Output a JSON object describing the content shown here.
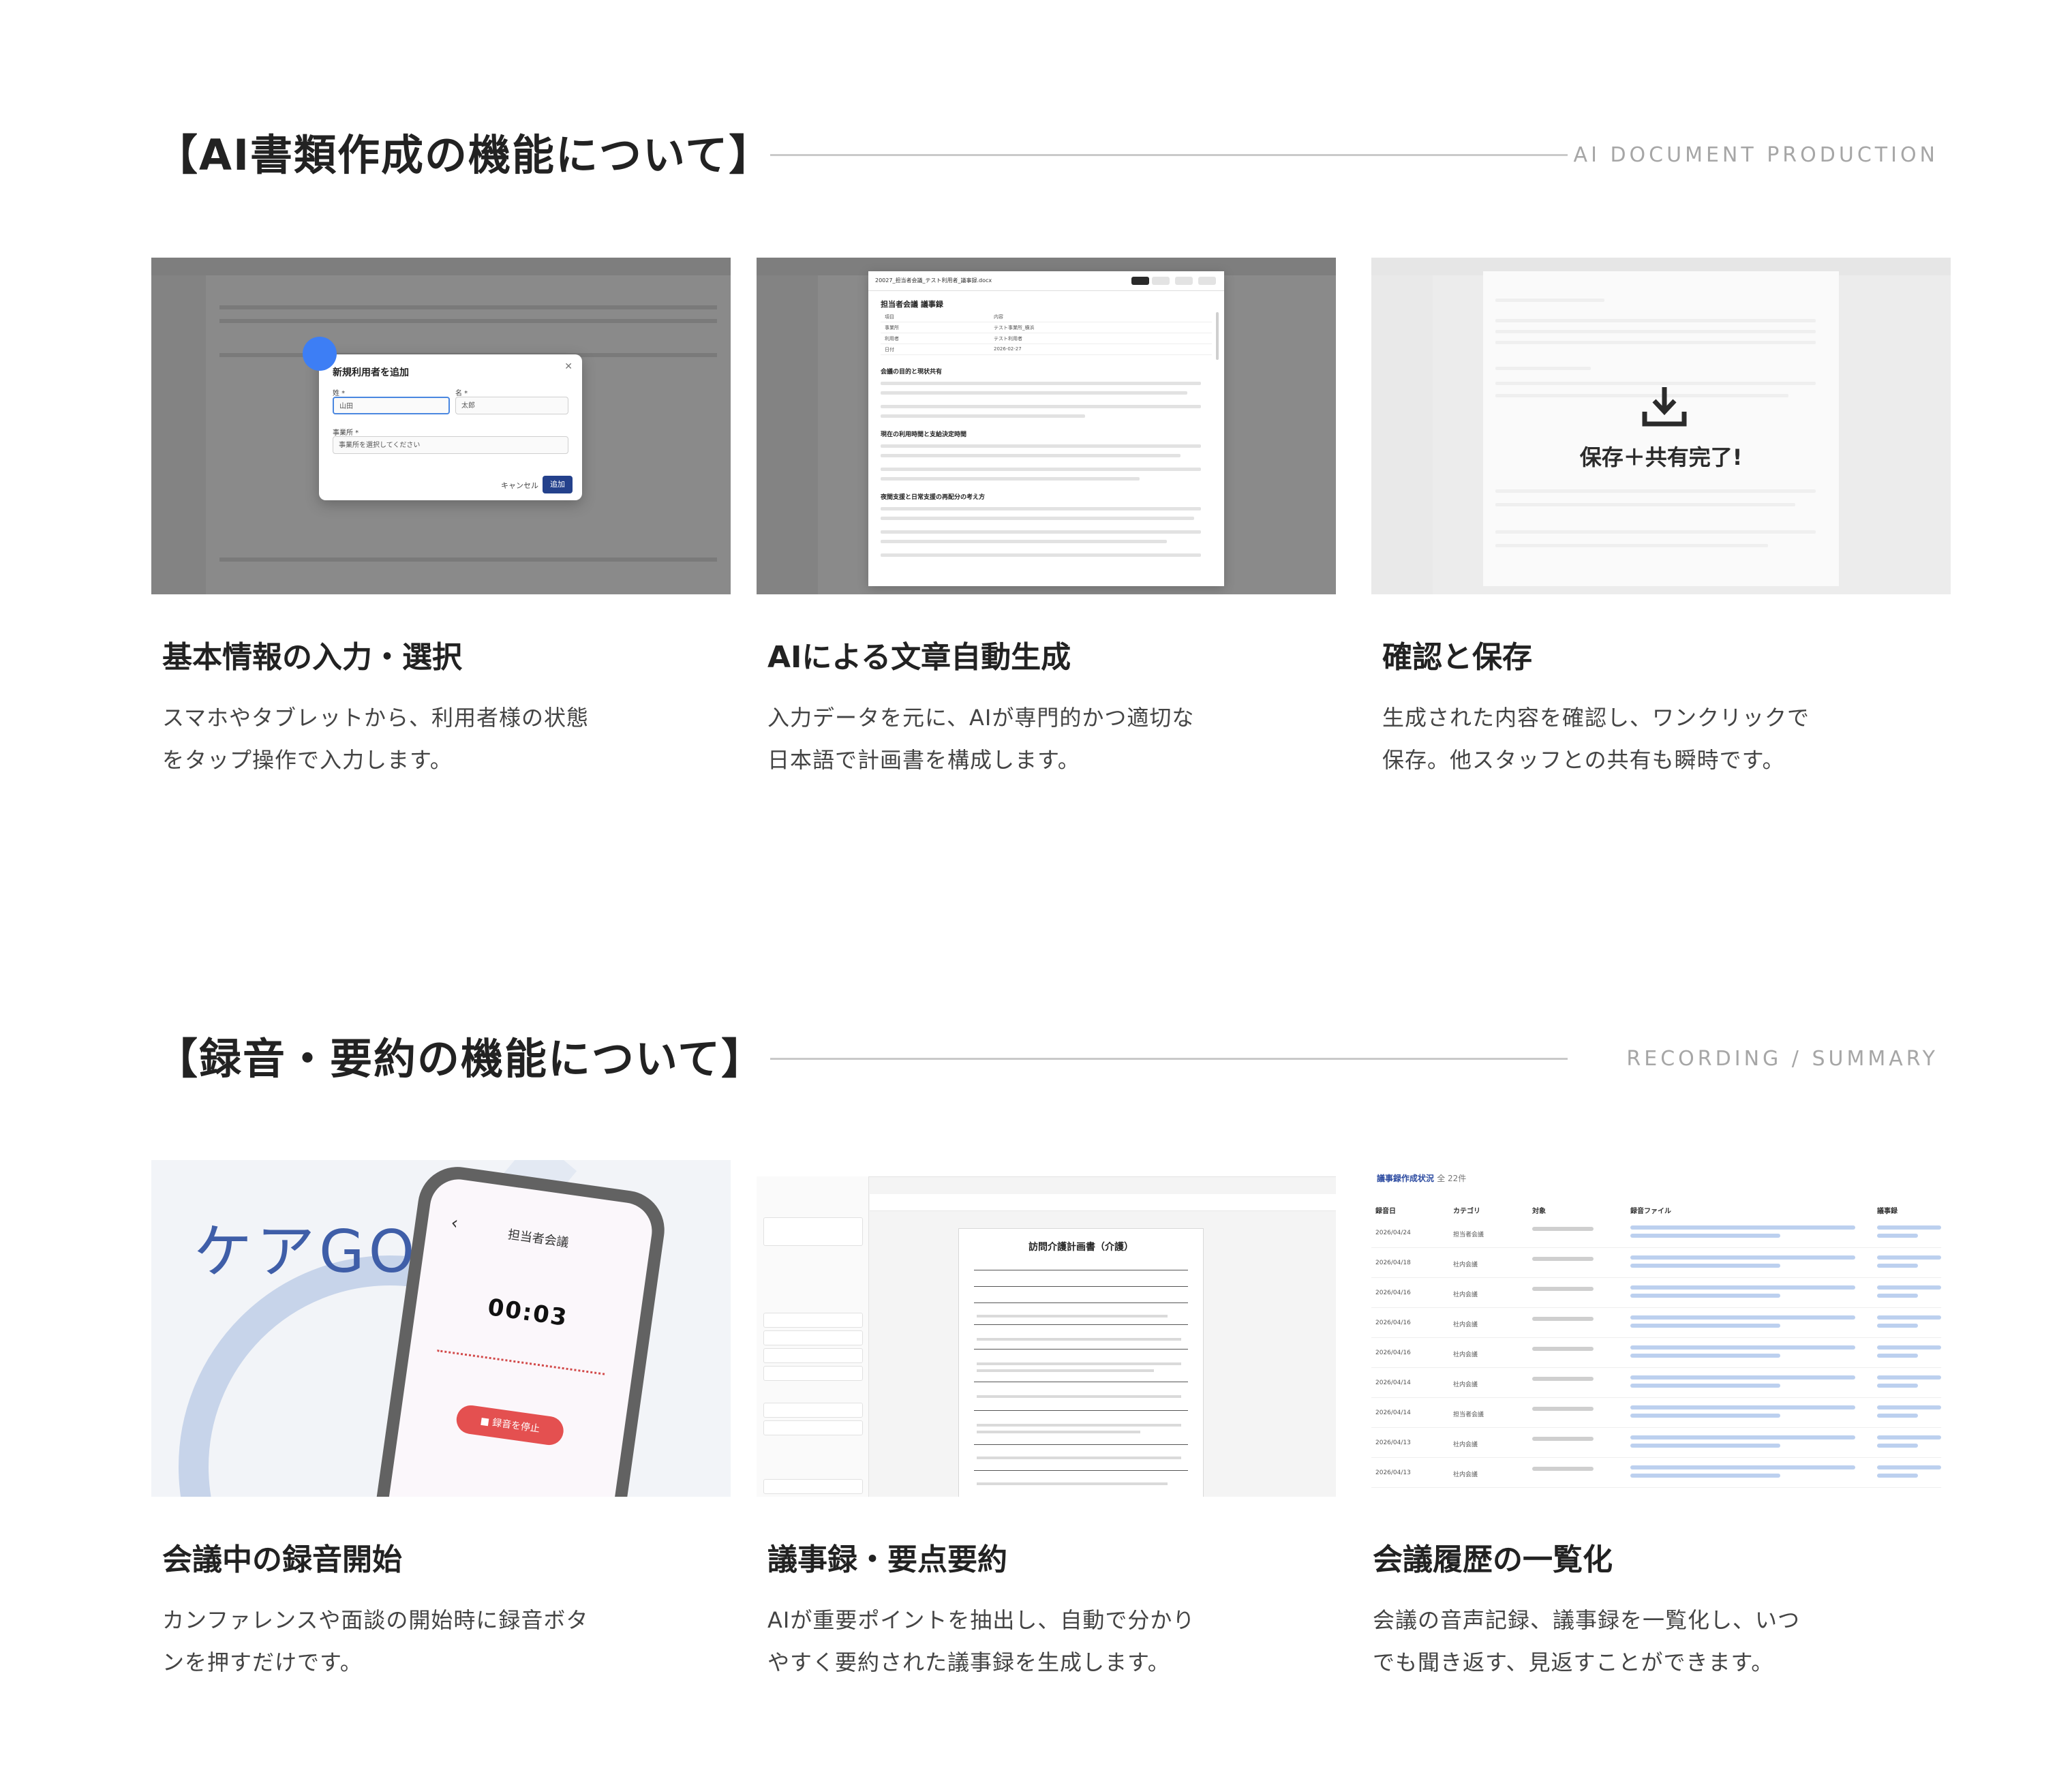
{
  "sections": [
    {
      "title": "【AI書類作成の機能について】",
      "title_en": "AI DOCUMENT PRODUCTION",
      "cards": [
        {
          "title": "基本情報の入力・選択",
          "desc": [
            "スマホやタブレットから、利用者様の状態",
            "をタップ操作で入力します。"
          ]
        },
        {
          "title": "AIによる文章自動生成",
          "desc": [
            "入力データを元に、AIが専門的かつ適切な",
            "日本語で計画書を構成します。"
          ]
        },
        {
          "title": "確認と保存",
          "desc": [
            "生成された内容を確認し、ワンクリックで",
            "保存。他スタッフとの共有も瞬時です。"
          ]
        }
      ]
    },
    {
      "title": "【録音・要約の機能について】",
      "title_en": "RECORDING / SUMMARY",
      "cards": [
        {
          "title": "会議中の録音開始",
          "desc": [
            "カンファレンスや面談の開始時に録音ボタ",
            "ンを押すだけです。"
          ]
        },
        {
          "title": "議事録・要点要約",
          "desc": [
            "AIが重要ポイントを抽出し、自動で分かり",
            "やすく要約された議事録を生成します。"
          ]
        },
        {
          "title": "会議履歴の一覧化",
          "desc": [
            "会議の音声記録、議事録を一覧化し、いつ",
            "でも聞き返す、見返すことができます。"
          ]
        }
      ]
    }
  ],
  "shot_input": {
    "modal_title": "新規利用者を追加",
    "last_name_label": "姓 *",
    "first_name_label": "名 *",
    "last_name_value": "山田",
    "first_name_value": "太郎",
    "office_label": "事業所 *",
    "office_placeholder": "事業所を選択してください",
    "cancel_label": "キャンセル",
    "add_label": "追加"
  },
  "shot_generate": {
    "file_name": "20027_担当者会議_テスト利用者_議事録.docx",
    "doc_title": "担当者会議 議事録",
    "table": [
      {
        "k": "項目",
        "v": "内容"
      },
      {
        "k": "事業所",
        "v": "テスト事業所_横浜"
      },
      {
        "k": "利用者",
        "v": "テスト利用者"
      },
      {
        "k": "日付",
        "v": "2026-02-27"
      }
    ],
    "headings": [
      "会議の目的と現状共有",
      "現在の利用時間と支給決定時間",
      "夜間支援と日常支援の再配分の考え方"
    ]
  },
  "shot_save": {
    "message": "保存＋共有完了!",
    "icon": "download-icon"
  },
  "shot_record": {
    "logo": "ケアGO",
    "screen_title": "担当者会議",
    "timer": "00:03",
    "stop_label": "録音を停止"
  },
  "shot_minutes": {
    "paper_title": "訪問介護計画書（介護）"
  },
  "shot_history": {
    "heading": "議事録作成状況",
    "count": "全 22件",
    "columns": [
      "録音日",
      "カテゴリ",
      "対象",
      "録音ファイル",
      "議事録"
    ],
    "rows": [
      {
        "date": "2026/04/24",
        "cat": "担当者会議"
      },
      {
        "date": "2026/04/18",
        "cat": "社内会議"
      },
      {
        "date": "2026/04/16",
        "cat": "社内会議"
      },
      {
        "date": "2026/04/16",
        "cat": "社内会議"
      },
      {
        "date": "2026/04/16",
        "cat": "社内会議"
      },
      {
        "date": "2026/04/14",
        "cat": "社内会議"
      },
      {
        "date": "2026/04/14",
        "cat": "担当者会議"
      },
      {
        "date": "2026/04/13",
        "cat": "社内会議"
      },
      {
        "date": "2026/04/13",
        "cat": "社内会議"
      }
    ]
  },
  "colors": {
    "accent_blue": "#3d7ef5",
    "record_red": "#e45050",
    "logo_blue": "#3f5ea8"
  }
}
